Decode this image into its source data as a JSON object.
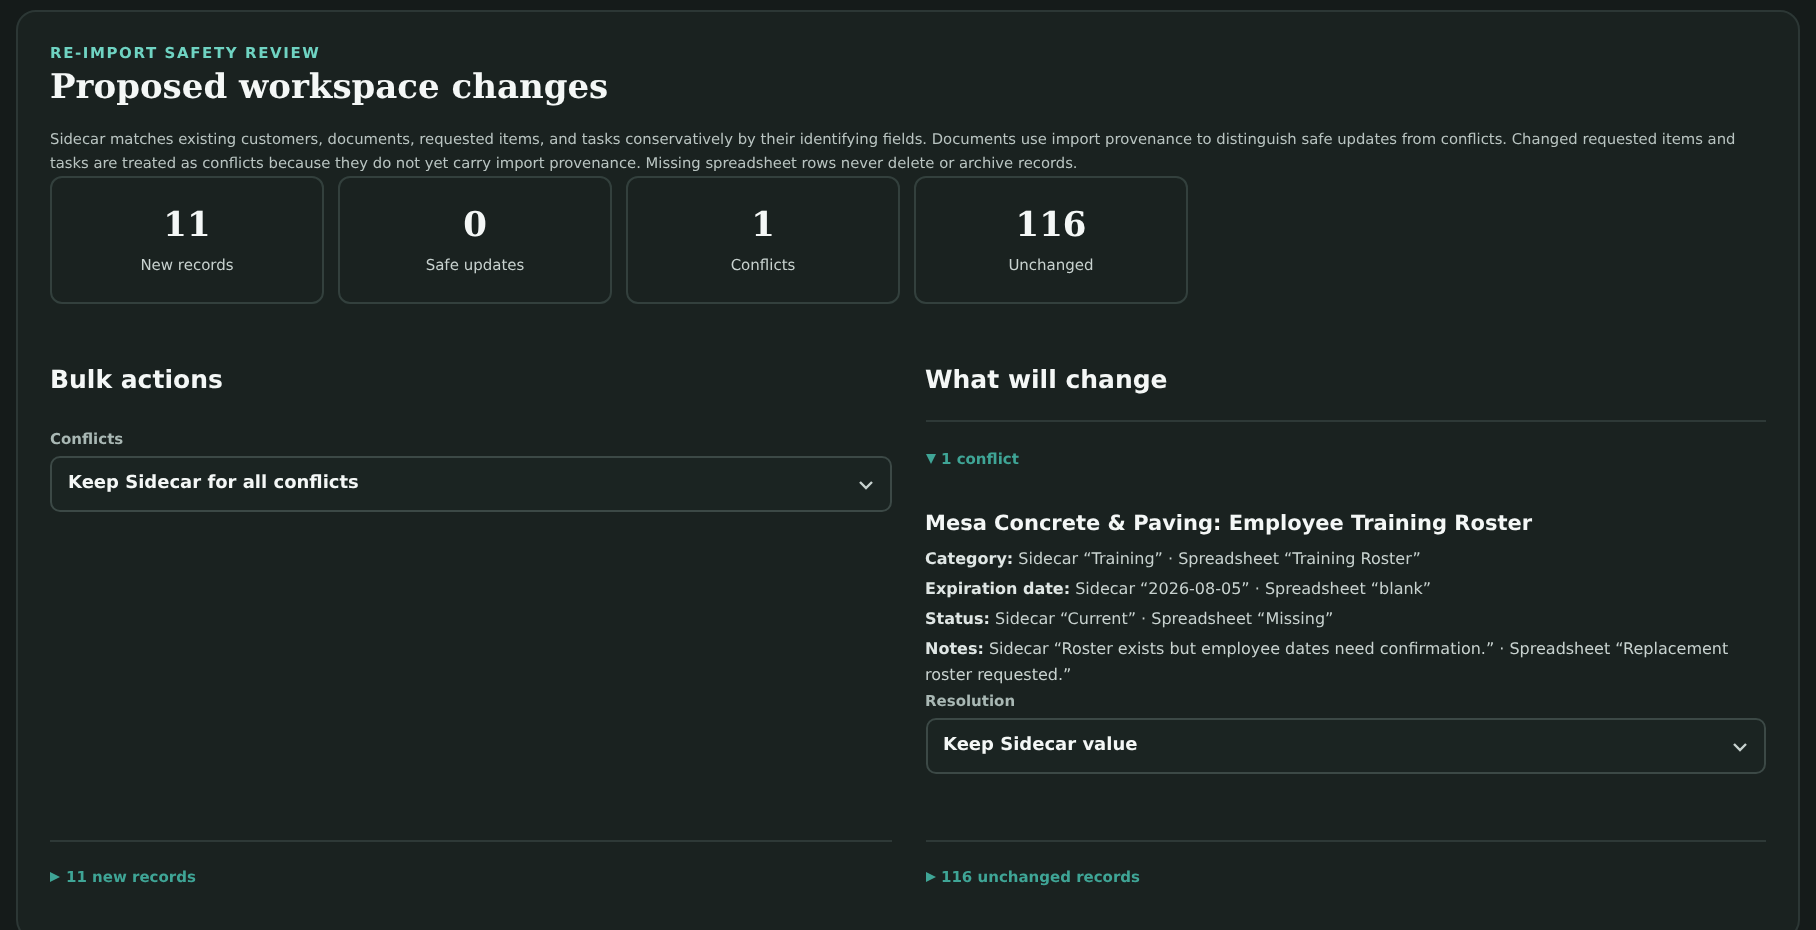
{
  "eyebrow": "RE-IMPORT SAFETY REVIEW",
  "title": "Proposed workspace changes",
  "description": "Sidecar matches existing customers, documents, requested items, and tasks conservatively by their identifying fields. Documents use import provenance to distinguish safe updates from conflicts. Changed requested items and tasks are treated as conflicts because they do not yet carry import provenance. Missing spreadsheet rows never delete or archive records.",
  "stats": [
    {
      "value": "11",
      "label": "New records"
    },
    {
      "value": "0",
      "label": "Safe updates"
    },
    {
      "value": "1",
      "label": "Conflicts"
    },
    {
      "value": "116",
      "label": "Unchanged"
    }
  ],
  "bulk": {
    "heading": "Bulk actions",
    "field_label": "Conflicts",
    "value": "Keep Sidecar for all conflicts",
    "footer": {
      "label": "11 new records",
      "expanded": false
    }
  },
  "changes": {
    "heading": "What will change",
    "group": {
      "label": "1 conflict",
      "expanded": true
    },
    "record": {
      "title": "Mesa Concrete & Paving: Employee Training Roster",
      "lines": [
        "**Category:** Sidecar “Training” · Spreadsheet “Training Roster”",
        "**Expiration date:** Sidecar “2026-08-05” · Spreadsheet “blank”",
        "**Status:** Sidecar “Current” · Spreadsheet “Missing”",
        "**Notes:** Sidecar “Roster exists but employee dates need confirmation.” · Spreadsheet “Replacement roster requested.”"
      ],
      "resolution_label": "Resolution",
      "resolution_value": "Keep Sidecar value"
    },
    "footer": {
      "label": "116 unchanged records",
      "expanded": false
    }
  }
}
